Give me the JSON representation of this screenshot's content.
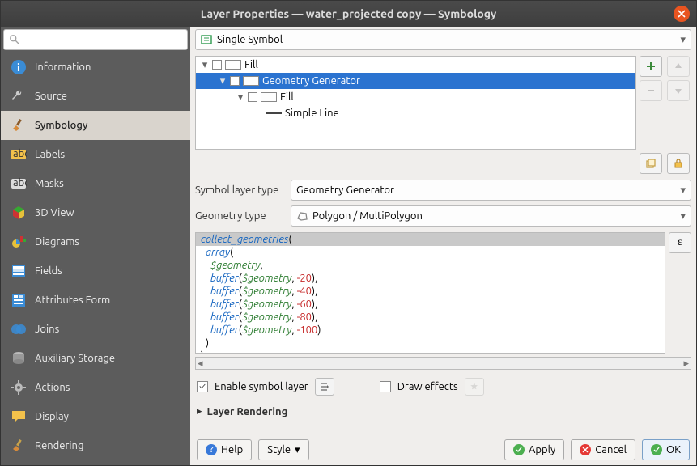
{
  "title": "Layer Properties — water_projected copy — Symbology",
  "sidebar": {
    "items": [
      {
        "label": "Information",
        "icon": "info"
      },
      {
        "label": "Source",
        "icon": "wrench"
      },
      {
        "label": "Symbology",
        "icon": "brush"
      },
      {
        "label": "Labels",
        "icon": "abc-y"
      },
      {
        "label": "Masks",
        "icon": "abc-g"
      },
      {
        "label": "3D View",
        "icon": "cube"
      },
      {
        "label": "Diagrams",
        "icon": "dia"
      },
      {
        "label": "Fields",
        "icon": "fields"
      },
      {
        "label": "Attributes Form",
        "icon": "form"
      },
      {
        "label": "Joins",
        "icon": "join"
      },
      {
        "label": "Auxiliary Storage",
        "icon": "db"
      },
      {
        "label": "Actions",
        "icon": "gear"
      },
      {
        "label": "Display",
        "icon": "speech"
      },
      {
        "label": "Rendering",
        "icon": "brush2"
      }
    ],
    "selected_index": 2
  },
  "symbol_type_combo": "Single Symbol",
  "tree": {
    "rows": [
      {
        "indent": 0,
        "expanded": true,
        "checkbox": true,
        "swatch": "rect",
        "label": "Fill"
      },
      {
        "indent": 1,
        "expanded": true,
        "checkbox": true,
        "swatch": "rect",
        "label": "Geometry Generator",
        "selected": true
      },
      {
        "indent": 2,
        "expanded": true,
        "checkbox": true,
        "swatch": "rect",
        "label": "Fill"
      },
      {
        "indent": 3,
        "expanded": false,
        "checkbox": false,
        "swatch": "line",
        "label": "Simple Line"
      }
    ]
  },
  "symbol_layer_type_label": "Symbol layer type",
  "symbol_layer_type_value": "Geometry Generator",
  "geometry_type_label": "Geometry type",
  "geometry_type_value": "Polygon / MultiPolygon",
  "expression_lines": [
    "collect_geometries(",
    "  array(",
    "    $geometry,",
    "    buffer($geometry, -20),",
    "    buffer($geometry, -40),",
    "    buffer($geometry, -60),",
    "    buffer($geometry, -80),",
    "    buffer($geometry, -100)",
    "  )",
    ")"
  ],
  "enable_symbol_layer": {
    "label": "Enable symbol layer",
    "checked": true
  },
  "draw_effects": {
    "label": "Draw effects",
    "checked": false
  },
  "layer_rendering": "Layer Rendering",
  "buttons": {
    "help": "Help",
    "style": "Style",
    "apply": "Apply",
    "cancel": "Cancel",
    "ok": "OK"
  }
}
